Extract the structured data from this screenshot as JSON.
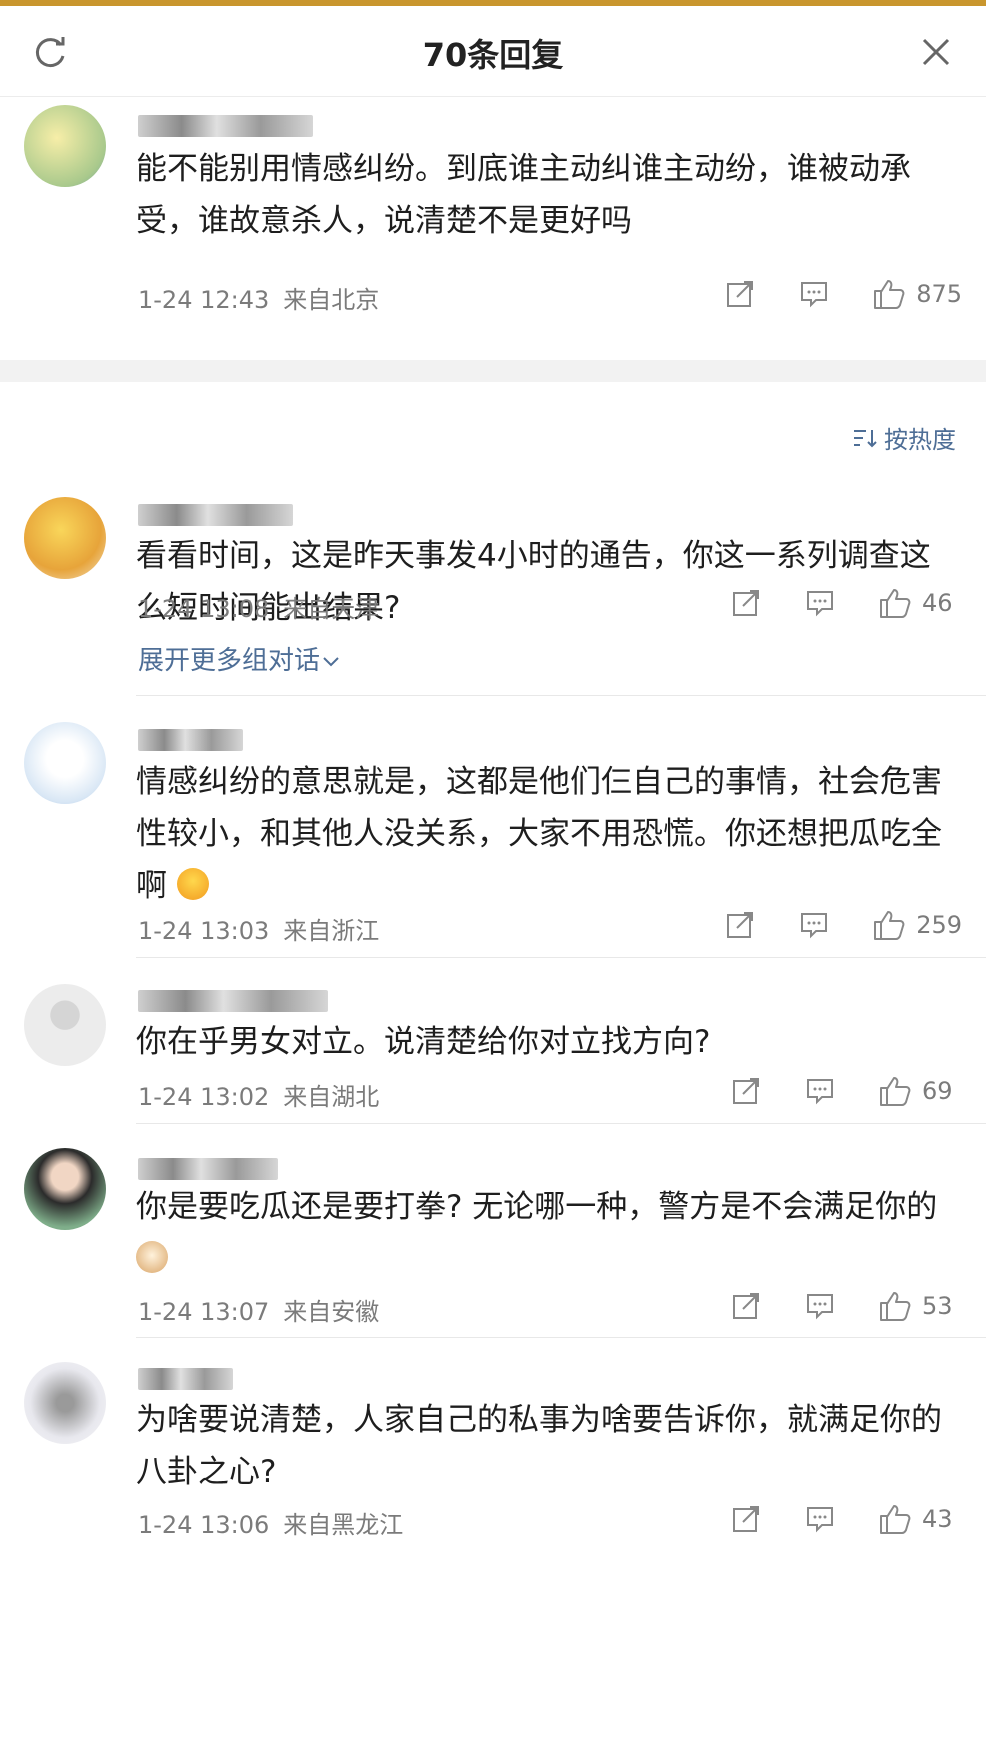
{
  "header": {
    "title": "70条回复"
  },
  "root": {
    "text": "能不能别用情感纠纷。到底谁主动纠谁主动纷，谁被动承受，谁故意杀人，说清楚不是更好吗",
    "time": "1-24 12:43",
    "location": "来自北京",
    "likes": "875"
  },
  "sort": {
    "label": "按热度"
  },
  "comments": [
    {
      "text": "看看时间，这是昨天事发4小时的通告，你这一系列调查这么短时间能出结果?",
      "time": "1-24 13:08",
      "location": "来自天津",
      "likes": "46",
      "expand": "展开更多组对话"
    },
    {
      "text": "情感纠纷的意思就是，这都是他们仨自己的事情，社会危害性较小，和其他人没关系，大家不用恐慌。你还想把瓜吃全啊",
      "time": "1-24 13:03",
      "location": "来自浙江",
      "likes": "259"
    },
    {
      "text": "你在乎男女对立。说清楚给你对立找方向?",
      "time": "1-24 13:02",
      "location": "来自湖北",
      "likes": "69"
    },
    {
      "text": "你是要吃瓜还是要打拳? 无论哪一种，警方是不会满足你的",
      "time": "1-24 13:07",
      "location": "来自安徽",
      "likes": "53"
    },
    {
      "text": "为啥要说清楚，人家自己的私事为啥要告诉你，就满足你的八卦之心?",
      "time": "1-24 13:06",
      "location": "来自黑龙江",
      "likes": "43"
    }
  ],
  "icons": {
    "refresh": "refresh-icon",
    "close": "close-icon",
    "repost": "repost-icon",
    "comment": "comment-icon",
    "like": "thumbs-up-icon",
    "sort": "sort-icon",
    "chevron": "chevron-down-icon"
  },
  "colors": {
    "link": "#4e6e96",
    "meta": "#7b7b7b",
    "text": "#1e1e1e",
    "accent_bar": "#c9962e"
  }
}
